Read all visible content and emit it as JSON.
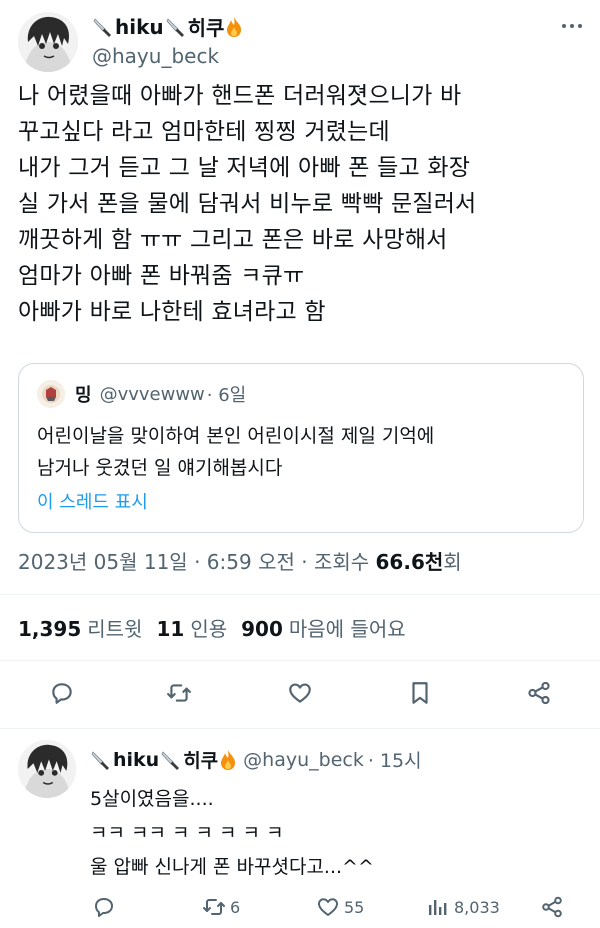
{
  "tweet": {
    "author": {
      "display_name": "hiku",
      "display_name_suffix": "히쿠",
      "handle": "@hayu_beck"
    },
    "text_lines": [
      "나 어렸을때 아빠가 핸드폰 더러워졋으니가 바",
      "꾸고싶다 라고 엄마한테 찡찡 거렸는데",
      "내가 그거 듣고 그 날 저녁에 아빠 폰 들고 화장",
      "실 가서 폰을 물에 담궈서 비누로 빡빡 문질러서",
      "깨끗하게 함 ㅠㅠ 그리고 폰은 바로 사망해서",
      "엄마가 아빠 폰 바꿔줌 ㅋ큐ㅠ",
      "아빠가 바로 나한테 효녀라고 함"
    ],
    "quote": {
      "display_name": "밍",
      "handle": "@vvvewww",
      "time": "· 6일",
      "text_lines": [
        "어린이날을 맞이하여 본인 어린이시절 제일 기억에",
        "남거나 웃겼던 일 얘기해봅시다"
      ],
      "thread_link": "이 스레드 표시"
    },
    "meta": {
      "date": "2023년 05월 11일",
      "time": "6:59 오전",
      "views_label": "조회수",
      "views_value": "66.6천",
      "views_unit": "회"
    },
    "stats": {
      "retweets_value": "1,395",
      "retweets_label": "리트윗",
      "quotes_value": "11",
      "quotes_label": "인용",
      "likes_value": "900",
      "likes_label": "마음에 들어요"
    }
  },
  "reply": {
    "author": {
      "display_name": "hiku",
      "display_name_suffix": "히쿠",
      "handle": "@hayu_beck",
      "time": "· 15시"
    },
    "text_lines": [
      "5살이였음을....",
      "ㅋㅋ ㅋㅋ ㅋ ㅋ ㅋ ㅋ ㅋ",
      "울 압빠 신나게 폰 바꾸셧다고...^^"
    ],
    "retweets": "6",
    "likes": "55",
    "views": "8,033"
  },
  "icons": {
    "knife": "knife-emoji-icon",
    "fire": "fire-emoji-icon",
    "reply": "reply-icon",
    "retweet": "retweet-icon",
    "like": "heart-icon",
    "bookmark": "bookmark-icon",
    "share": "share-icon",
    "views": "views-icon",
    "more": "more-icon"
  },
  "colors": {
    "text": "#0f1419",
    "secondary": "#536471",
    "link": "#1d9bf0",
    "border": "#cfd9de",
    "fire": "#f4900c"
  }
}
